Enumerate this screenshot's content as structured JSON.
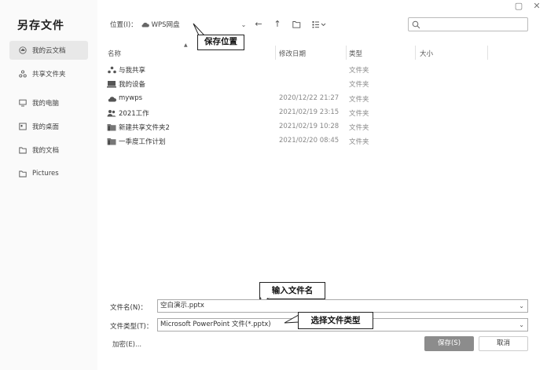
{
  "window": {
    "minimize": "▢",
    "close": "✕"
  },
  "title": "另存文件",
  "sidebar": {
    "items": [
      {
        "label": "我的云文档"
      },
      {
        "label": "共享文件夹"
      },
      {
        "label": "我的电脑"
      },
      {
        "label": "我的桌面"
      },
      {
        "label": "我的文档"
      },
      {
        "label": "Pictures"
      }
    ]
  },
  "location": {
    "label": "位置(I)：",
    "value": "WPS网盘"
  },
  "columns": {
    "name": "名称",
    "modified": "修改日期",
    "type": "类型",
    "size": "大小"
  },
  "files": [
    {
      "name": "与我共享",
      "date": "",
      "type": "文件夹",
      "icon": "share-icon"
    },
    {
      "name": "我的设备",
      "date": "",
      "type": "文件夹",
      "icon": "device-icon"
    },
    {
      "name": "mywps",
      "date": "2020/12/22 21:27",
      "type": "文件夹",
      "icon": "cloud-icon"
    },
    {
      "name": "2021工作",
      "date": "2021/02/19 23:15",
      "type": "文件夹",
      "icon": "team-icon"
    },
    {
      "name": "新建共享文件夹2",
      "date": "2021/02/19 10:28",
      "type": "文件夹",
      "icon": "folder-icon"
    },
    {
      "name": "一季度工作计划",
      "date": "2021/02/20 08:45",
      "type": "文件夹",
      "icon": "folder-icon"
    }
  ],
  "filename": {
    "label": "文件名(N)：",
    "value": "空白演示.pptx"
  },
  "filetype": {
    "label": "文件类型(T)：",
    "value": "Microsoft PowerPoint 文件(*.pptx)"
  },
  "encrypt": {
    "text": "加密(E)..."
  },
  "buttons": {
    "save": "保存(S)",
    "cancel": "取消"
  },
  "callouts": {
    "location": "保存位置",
    "filename": "输入文件名",
    "filetype": "选择文件类型"
  }
}
